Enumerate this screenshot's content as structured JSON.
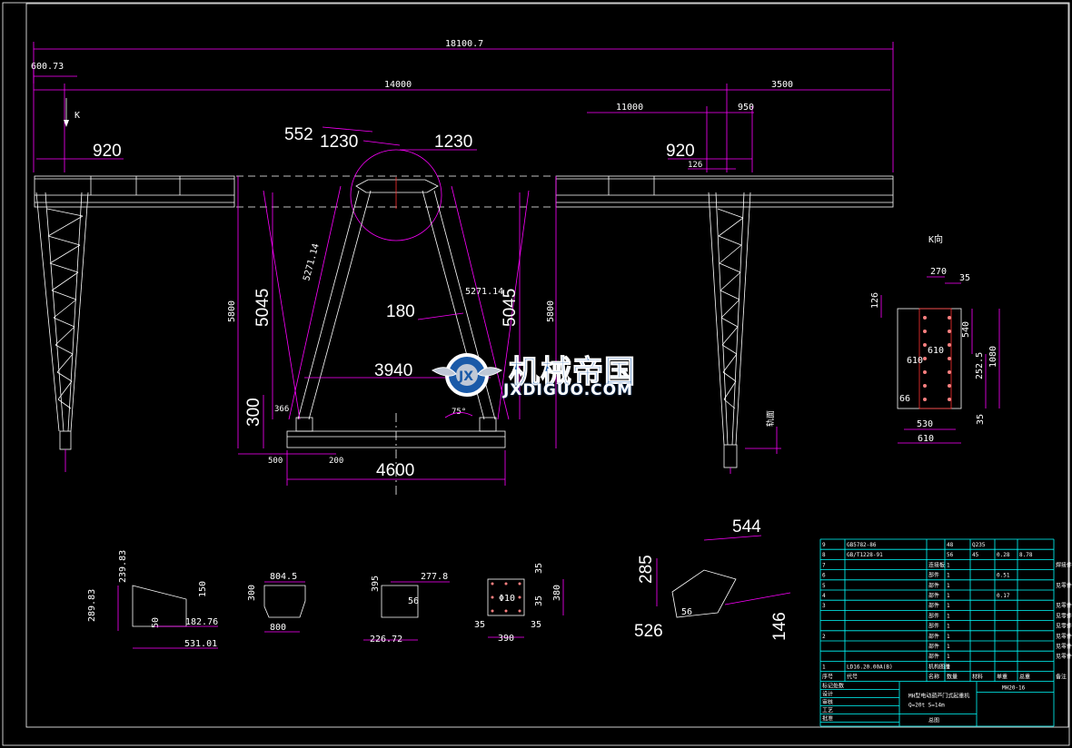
{
  "view_labels": {
    "arrow_k": "K",
    "section_k": "K向"
  },
  "overall": {
    "total_length": "18100.7",
    "left_overhang": "600.73",
    "span": "14000",
    "right_cantilever": "3500",
    "right_span_part": "11000",
    "right_offset": "950",
    "right_small": "126"
  },
  "frame": {
    "left_920": "920",
    "right_920": "920",
    "hinge_552": "552",
    "hinge_1230_left": "1230",
    "hinge_1230_right": "1230",
    "leg_len_left": "5271.14",
    "leg_len_right": "5271.14",
    "height_5800_left": "5800",
    "height_5800_right": "5800",
    "height_5045_left": "5045",
    "height_5045_right": "5045",
    "width_180": "180",
    "inner_3940": "3940",
    "base_300": "300",
    "base_366": "366",
    "angle": "75°",
    "base_500": "500",
    "base_200": "200",
    "base_4600": "4600",
    "ground_mark": "轨面"
  },
  "section_k": {
    "d270": "270",
    "d35": "35",
    "d126": "126",
    "d540": "540",
    "d610v": "610",
    "d610": "610",
    "d1080": "1080",
    "d252": "252.5",
    "d66": "66",
    "d35b": "35",
    "d530": "530",
    "d610b": "610"
  },
  "parts": {
    "p1": {
      "a": "289.83",
      "b": "239.83",
      "c": "150",
      "d": "50",
      "e": "182.76",
      "f": "531.01"
    },
    "p2": {
      "a": "804.5",
      "b": "300",
      "c": "800"
    },
    "p3": {
      "a": "277.8",
      "b": "395",
      "c": "56",
      "d": "226.72"
    },
    "p4": {
      "a": "35",
      "b": "35",
      "c": "380",
      "d": "35",
      "e": "35",
      "f": "390",
      "g": "Φ10"
    },
    "p5": {
      "a": "544",
      "b": "285",
      "c": "56",
      "d": "526",
      "e": "146"
    }
  },
  "title_block": {
    "rows": [
      {
        "no": "9",
        "code": "GB5782-86",
        "name": "",
        "qty": "48",
        "mat": "Q235",
        "w1": "",
        "w2": "",
        "note": ""
      },
      {
        "no": "8",
        "code": "GB/T1228-91",
        "name": "",
        "qty": "56",
        "mat": "45",
        "w1": "0.28",
        "w2": "8.78",
        "note": ""
      },
      {
        "no": "7",
        "code": "",
        "name": "连接板",
        "qty": "1",
        "mat": "",
        "w1": "",
        "w2": "",
        "note": "焊接件"
      },
      {
        "no": "6",
        "code": "",
        "name": "部件",
        "qty": "1",
        "mat": "",
        "w1": "0.51",
        "w2": "",
        "note": ""
      },
      {
        "no": "5",
        "code": "",
        "name": "部件",
        "qty": "1",
        "mat": "",
        "w1": "",
        "w2": "",
        "note": "见零件"
      },
      {
        "no": "4",
        "code": "",
        "name": "部件",
        "qty": "1",
        "mat": "",
        "w1": "0.17",
        "w2": "",
        "note": ""
      },
      {
        "no": "3",
        "code": "",
        "name": "部件",
        "qty": "1",
        "mat": "",
        "w1": "",
        "w2": "",
        "note": "见零件 δ=12.5"
      },
      {
        "no": "",
        "code": "",
        "name": "部件",
        "qty": "1",
        "mat": "",
        "w1": "",
        "w2": "",
        "note": "见零件 δ=17.5"
      },
      {
        "no": "",
        "code": "",
        "name": "部件",
        "qty": "1",
        "mat": "",
        "w1": "",
        "w2": "",
        "note": "见零件 δ=11.5"
      },
      {
        "no": "2",
        "code": "",
        "name": "部件",
        "qty": "1",
        "mat": "",
        "w1": "",
        "w2": "",
        "note": "见零件 δ=8"
      },
      {
        "no": "",
        "code": "",
        "name": "部件",
        "qty": "1",
        "mat": "",
        "w1": "",
        "w2": "",
        "note": "见零件 δ=7.5"
      },
      {
        "no": "",
        "code": "",
        "name": "部件",
        "qty": "1",
        "mat": "",
        "w1": "",
        "w2": "",
        "note": "见零件 δ=6"
      },
      {
        "no": "1",
        "code": "LD16.20.00A(B)",
        "name": "机构图册",
        "qty": "1",
        "mat": "",
        "w1": "",
        "w2": "",
        "note": ""
      }
    ],
    "header": [
      "序号",
      "代号",
      "名称",
      "数量",
      "材料",
      "单重",
      "总重",
      "备注"
    ],
    "drawing_no": "MH20-16",
    "title_line1": "MH型电动葫芦门式起重机",
    "title_line2": "Q=20t S=14m",
    "sign_rows": [
      "标记处数",
      "设计",
      "审核",
      "工艺",
      "批准"
    ],
    "sheet": "总图"
  },
  "watermark": {
    "cn": "机械帝国",
    "en": "JXDIGUO.COM"
  }
}
